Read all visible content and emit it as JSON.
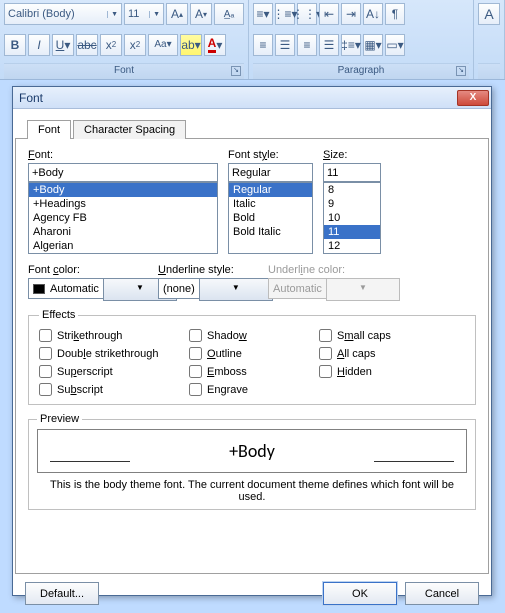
{
  "ribbon": {
    "font_group": {
      "label": "Font",
      "font_name": "Calibri (Body)",
      "font_size": "11"
    },
    "paragraph_group": {
      "label": "Paragraph"
    }
  },
  "dialog": {
    "title": "Font",
    "tabs": {
      "font": "Font",
      "spacing": "Character Spacing"
    },
    "font": {
      "label_html": "Font:",
      "value": "+Body",
      "list": [
        "+Body",
        "+Headings",
        "Agency FB",
        "Aharoni",
        "Algerian"
      ]
    },
    "style": {
      "label_html": "Font style:",
      "value": "Regular",
      "list": [
        "Regular",
        "Italic",
        "Bold",
        "Bold Italic"
      ]
    },
    "size": {
      "label_html": "Size:",
      "value": "11",
      "list": [
        "8",
        "9",
        "10",
        "11",
        "12"
      ]
    },
    "font_color": {
      "label_html": "Font color:",
      "value": "Automatic"
    },
    "underline_style": {
      "label_html": "Underline style:",
      "value": "(none)"
    },
    "underline_color": {
      "label_html": "Underline color:",
      "value": "Automatic"
    },
    "effects": {
      "legend": "Effects",
      "items": {
        "strikethrough": "Strikethrough",
        "double_strike": "Double strikethrough",
        "superscript": "Superscript",
        "subscript": "Subscript",
        "shadow": "Shadow",
        "outline": "Outline",
        "emboss": "Emboss",
        "engrave": "Engrave",
        "smallcaps": "Small caps",
        "allcaps": "All caps",
        "hidden": "Hidden"
      }
    },
    "preview": {
      "legend": "Preview",
      "sample": "+Body",
      "desc": "This is the body theme font. The current document theme defines which font will be used."
    },
    "buttons": {
      "default": "Default...",
      "ok": "OK",
      "cancel": "Cancel"
    }
  }
}
